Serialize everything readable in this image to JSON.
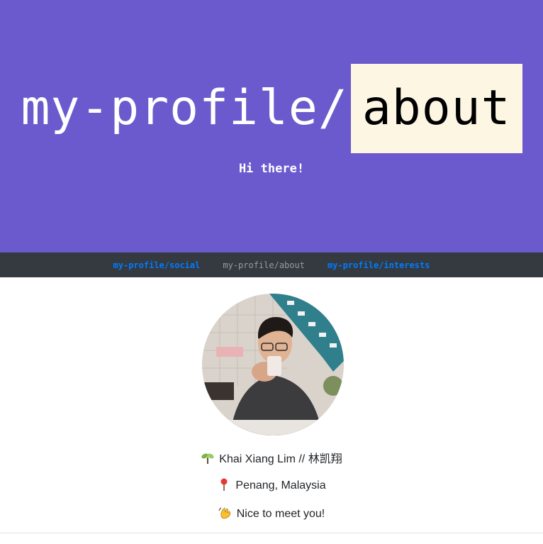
{
  "header": {
    "title_prefix": "my-profile/",
    "title_highlight": "about",
    "subtitle": "Hi there!"
  },
  "nav": {
    "items": [
      {
        "label": "my-profile/social",
        "active": false
      },
      {
        "label": "my-profile/about",
        "active": true
      },
      {
        "label": "my-profile/interests",
        "active": false
      }
    ]
  },
  "profile": {
    "name_line": "Khai Xiang Lim // 林凯翔",
    "name_icon": "seedling-icon",
    "location_line": "Penang, Malaysia",
    "location_icon": "round-pushpin-icon",
    "greeting_line": "Nice to meet you!",
    "greeting_icon": "waving-hand-icon"
  },
  "colors": {
    "hero_bg": "#6a5acd",
    "highlight_bg": "#fdf6e3",
    "navbar_bg": "#343a40",
    "nav_link": "#007bff",
    "nav_active": "#9a9a9a"
  }
}
